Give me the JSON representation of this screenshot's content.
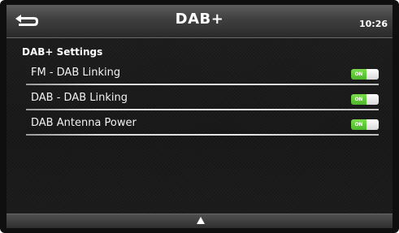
{
  "header": {
    "title": "DAB+",
    "time": "10:26",
    "back_icon": "return-arrow-icon"
  },
  "settings": {
    "heading": "DAB+ Settings",
    "items": [
      {
        "label": "FM - DAB Linking",
        "toggle_label": "ON",
        "state": "on"
      },
      {
        "label": "DAB - DAB Linking",
        "toggle_label": "ON",
        "state": "on"
      },
      {
        "label": "DAB Antenna Power",
        "toggle_label": "ON",
        "state": "on"
      }
    ]
  },
  "footer": {
    "scroll_icon": "triangle-up-icon"
  },
  "colors": {
    "toggle_on": "#5cc735",
    "background": "#181818",
    "header": "#3f3f3f"
  }
}
